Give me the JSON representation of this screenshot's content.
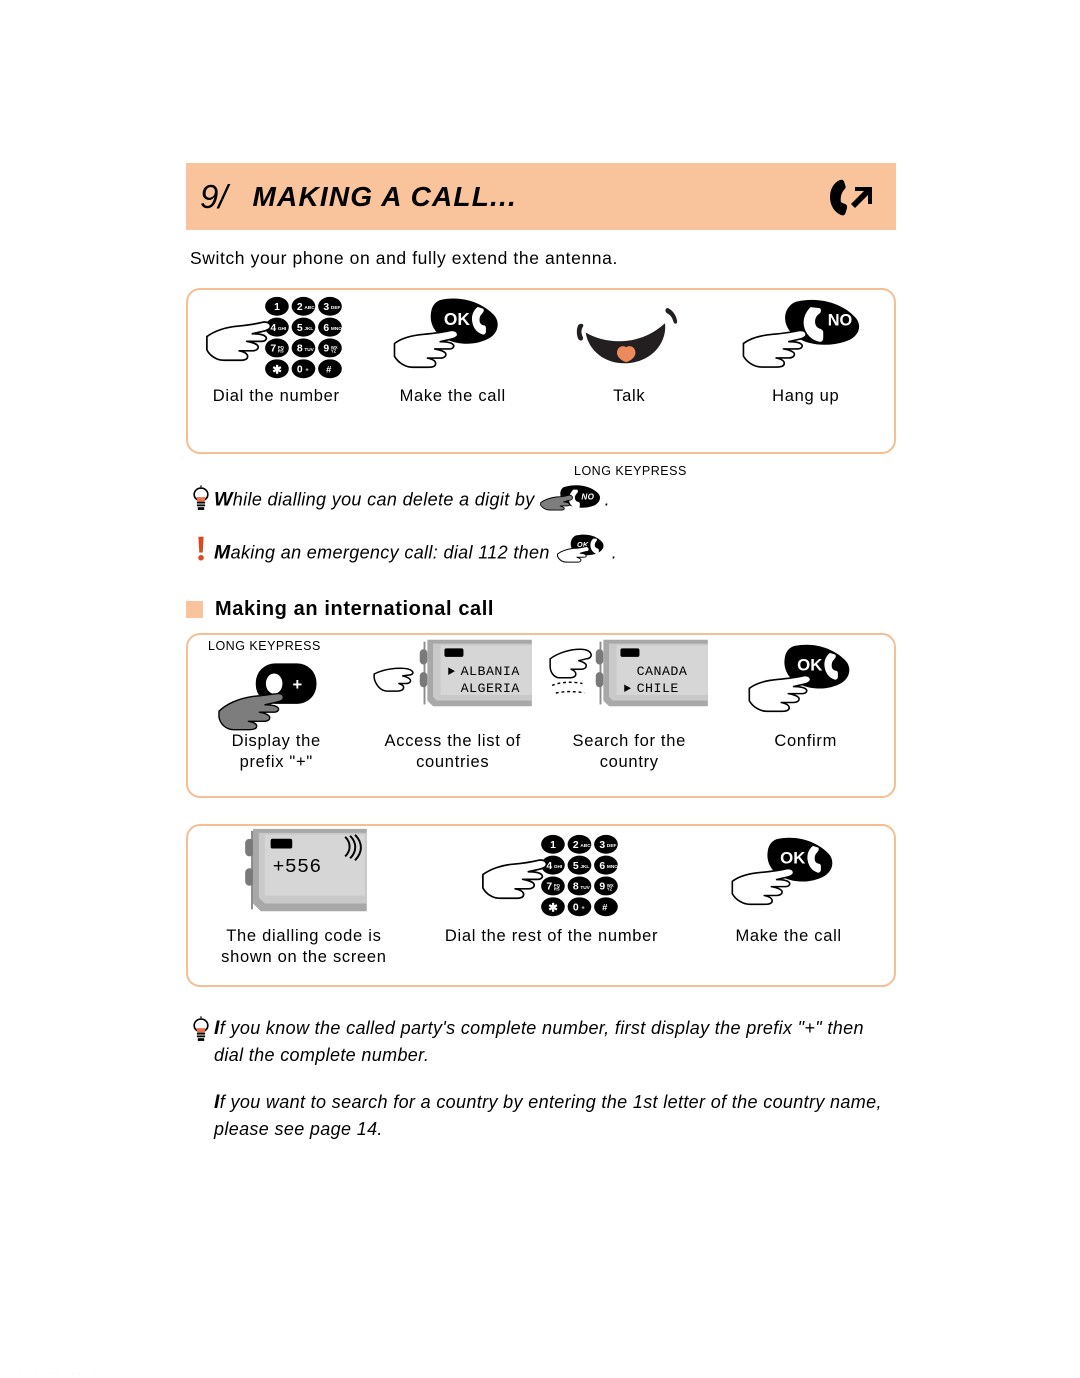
{
  "header": {
    "number": "9/",
    "title": "MAKING A CALL...",
    "icon": "phone-outgoing-call-icon",
    "band_color": "#f9c39b"
  },
  "intro": {
    "text": "Switch your phone on and fully extend the antenna."
  },
  "basic_call": {
    "steps": [
      {
        "label": "Dial the number",
        "art": "keypad-with-pointing-hand-icon"
      },
      {
        "label": "Make the call",
        "art": "ok-key-with-hand-icon"
      },
      {
        "label": "Talk",
        "art": "talking-mouth-icon"
      },
      {
        "label": "Hang up",
        "art": "no-key-with-hand-icon"
      }
    ]
  },
  "tips": {
    "tip1": {
      "lead": "W",
      "rest": "hile dialling you can delete a digit by",
      "trailing": ".",
      "icon": "lightbulb-icon",
      "key_icon": "no-key-with-grey-hand-icon",
      "keypress_note": "LONG KEYPRESS"
    },
    "tip2": {
      "lead": "M",
      "rest": "aking an emergency call: dial 112 then",
      "trailing": ".",
      "icon": "exclamation-icon",
      "key_icon": "ok-key-with-hand-icon"
    },
    "tip3": {
      "lead": "I",
      "rest": "f you know the called party's complete number, first display the prefix \"+\" then dial the complete number.",
      "icon": "lightbulb-icon"
    },
    "tip4": {
      "lead": "I",
      "rest": "f you want to search for a country by entering the 1st letter of the country name, please see page 14."
    }
  },
  "section": {
    "bullet_color": "#f9c39b",
    "title": "Making an international call"
  },
  "international_call": {
    "steps": [
      {
        "label": "Display the\nprefix \"+\"",
        "art": "zero-plus-key-with-grey-hand-icon",
        "note": "LONG KEYPRESS"
      },
      {
        "label": "Access the list of\ncountries",
        "art": "phone-screen-country-list-icon",
        "screen": {
          "line1": "ALBANIA",
          "line2": "ALGERIA",
          "selected": "ALBANIA"
        }
      },
      {
        "label": "Search for the\ncountry",
        "art": "phone-screen-country-list-scrolled-icon",
        "screen": {
          "line1": "CANADA",
          "line2": "CHILE",
          "selected": "CHILE"
        }
      },
      {
        "label": "Confirm",
        "art": "ok-key-with-hand-icon"
      }
    ]
  },
  "dialling_code": {
    "steps": [
      {
        "label": "The dialling code is\nshown on the screen",
        "art": "phone-screen-dialling-code-icon",
        "screen": {
          "value": "+556"
        }
      },
      {
        "label": "Dial the rest of the number",
        "art": "keypad-with-pointing-hand-icon"
      },
      {
        "label": "Make the call",
        "art": "ok-key-with-hand-icon"
      }
    ]
  },
  "keypad": {
    "keys": [
      {
        "digit": "1",
        "letters": ""
      },
      {
        "digit": "2",
        "letters": "ABC"
      },
      {
        "digit": "3",
        "letters": "DEF"
      },
      {
        "digit": "4",
        "letters": "GHI"
      },
      {
        "digit": "5",
        "letters": "JKL"
      },
      {
        "digit": "6",
        "letters": "MNO"
      },
      {
        "digit": "7",
        "letters": "PQRS"
      },
      {
        "digit": "8",
        "letters": "TUV"
      },
      {
        "digit": "9",
        "letters": "WXYZ"
      },
      {
        "digit": "✱",
        "letters": ""
      },
      {
        "digit": "0",
        "letters": "+"
      },
      {
        "digit": "#",
        "letters": ""
      }
    ]
  },
  "footer": {
    "faint_text": "............"
  }
}
